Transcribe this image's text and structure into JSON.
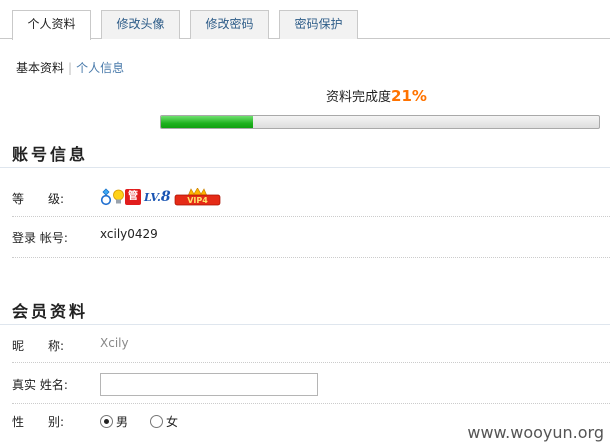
{
  "tabs": [
    {
      "label": "个人资料"
    },
    {
      "label": "修改头像"
    },
    {
      "label": "修改密码"
    },
    {
      "label": "密码保护"
    }
  ],
  "subnav": {
    "current": "基本资料",
    "separator": "|",
    "link": "个人信息"
  },
  "completion": {
    "label": "资料完成度",
    "percent_text": "21%",
    "value": 21
  },
  "account": {
    "title": "账号信息",
    "level_label": "等　　级:",
    "level_icons": {
      "guan": "管",
      "lv_prefix": "LV.",
      "lv_num": "8",
      "vip": "VIP4"
    },
    "login_label": "登录 帐号:",
    "login_value": "xcily0429"
  },
  "member": {
    "title": "会员资料",
    "nickname_label": "昵　　称:",
    "nickname_value": "Xcily",
    "realname_label": "真实 姓名:",
    "realname_value": "",
    "gender_label": "性　　别:",
    "gender_options": [
      "男",
      "女"
    ],
    "gender_selected": "男"
  },
  "watermark": "www.wooyun.org",
  "colors": {
    "accent_orange": "#ff7300",
    "progress_green": "#1fb21f",
    "tab_link": "#2d5c88"
  }
}
